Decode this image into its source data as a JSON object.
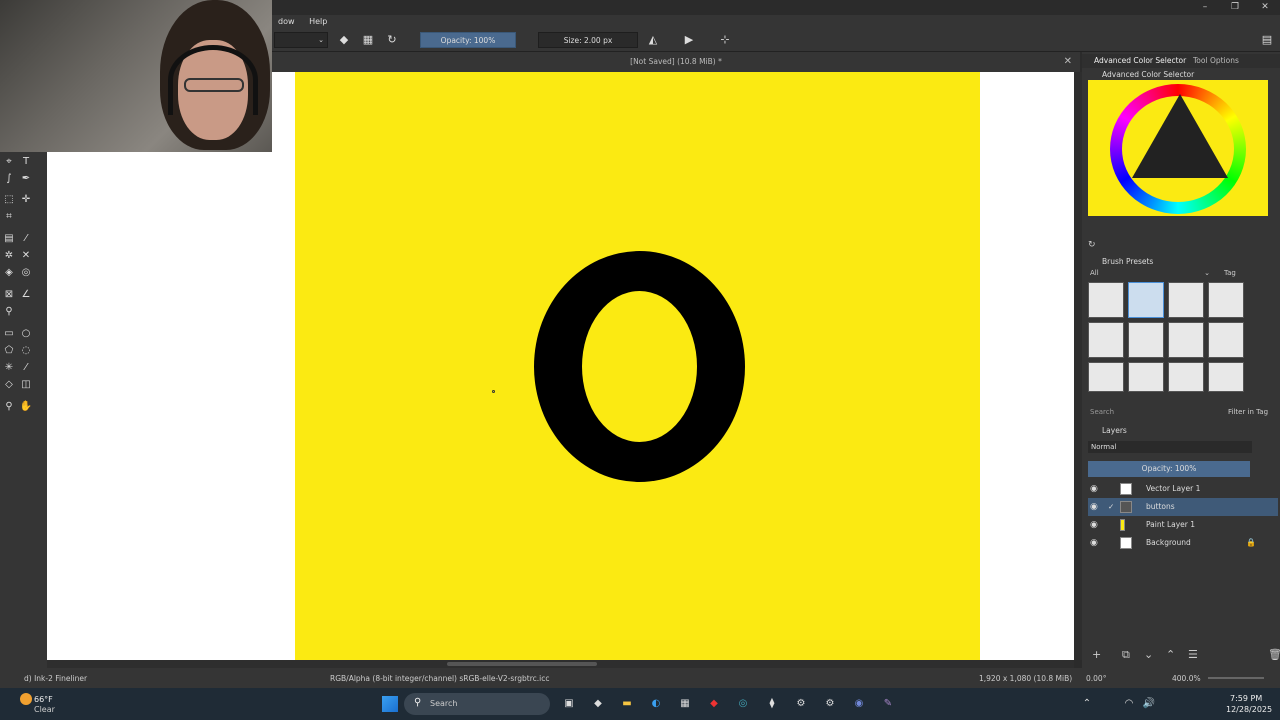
{
  "menubar": {
    "items": [
      "dow",
      "Help"
    ]
  },
  "toolbar": {
    "opacity": "Opacity: 100%",
    "size": "Size: 2.00 px"
  },
  "document": {
    "title": "[Not Saved] (10.8 MiB) *"
  },
  "canvas": {
    "letter": "O",
    "colors": {
      "background": "#ffffff",
      "fill": "#fbea12",
      "ink": "#000000"
    }
  },
  "right_tabs": {
    "advanced_color_selector": "Advanced Color Selector",
    "tool_options": "Tool Options"
  },
  "color_selector": {
    "title": "Advanced Color Selector"
  },
  "brush_presets": {
    "title": "Brush Presets",
    "filter_all": "All",
    "tag": "Tag",
    "search_placeholder": "Search",
    "filter_in_tag": "Filter in Tag"
  },
  "layers": {
    "title": "Layers",
    "blend_mode": "Normal",
    "opacity": "Opacity:  100%",
    "items": [
      {
        "name": "Vector Layer 1"
      },
      {
        "name": "buttons"
      },
      {
        "name": "Paint Layer 1"
      },
      {
        "name": "Background"
      }
    ]
  },
  "statusbar": {
    "brush": "d) Ink-2 Fineliner",
    "color_info": "RGB/Alpha (8-bit integer/channel)  sRGB-elle-V2-srgbtrc.icc",
    "image_info": "1,920 x 1,080 (10.8 MiB)",
    "rotation": "0.00°",
    "zoom": "400.0%"
  },
  "taskbar": {
    "weather_temp": "66°F",
    "weather_desc": "Clear",
    "search_placeholder": "Search",
    "time": "7:59 PM",
    "date": "12/28/2025"
  }
}
